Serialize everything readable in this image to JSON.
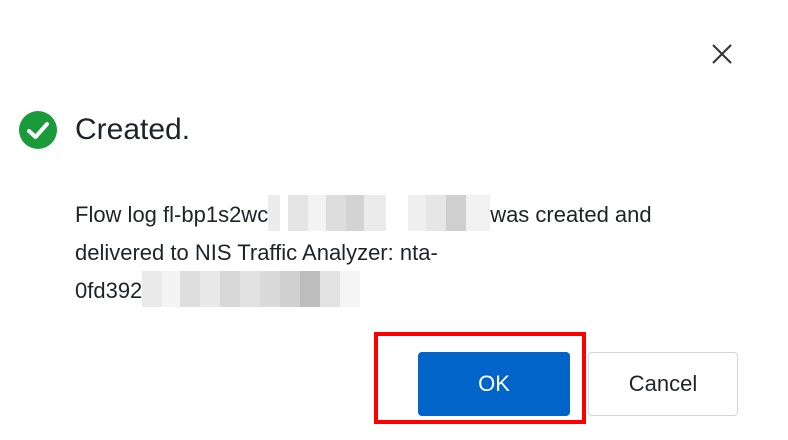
{
  "dialog": {
    "title": "Created.",
    "message": {
      "line1_start": "Flow log fl-bp1s2wc",
      "line1_end": "was created and",
      "line2": "delivered to NIS Traffic Analyzer: nta-",
      "line3_start": "0fd392"
    },
    "buttons": {
      "ok_label": "OK",
      "cancel_label": "Cancel"
    }
  },
  "icons": {
    "close": "close-icon",
    "success": "check-circle-icon"
  },
  "colors": {
    "success": "#1a9a3a",
    "primary": "#0064c8",
    "highlight": "#ff0000",
    "text": "#1f2329"
  }
}
